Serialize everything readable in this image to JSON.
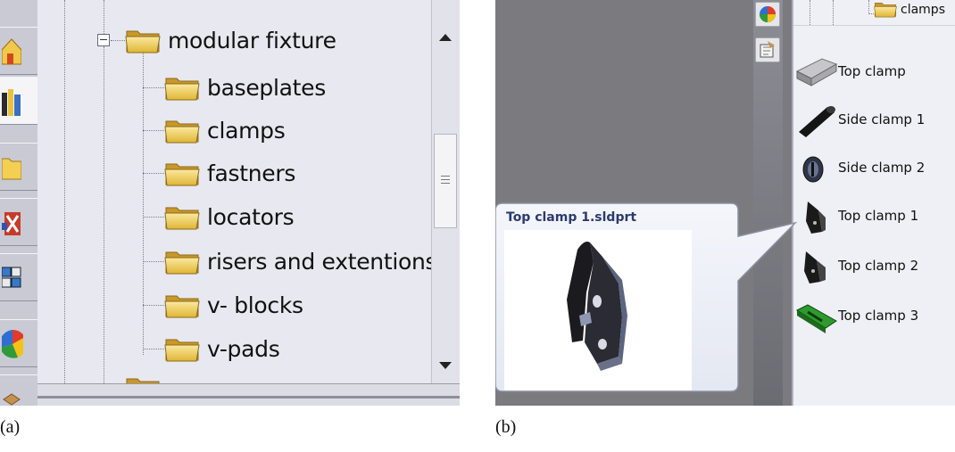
{
  "panel_a": {
    "caption": "(a)",
    "tree": {
      "parent_label": "modular fixture",
      "children": [
        {
          "label": "baseplates"
        },
        {
          "label": "clamps"
        },
        {
          "label": "fastners"
        },
        {
          "label": "locators"
        },
        {
          "label": "risers and extentions"
        },
        {
          "label": "v- blocks"
        },
        {
          "label": "v-pads"
        }
      ]
    },
    "toolbar_icons": [
      "home-icon",
      "design-library-icon",
      "folder-icon",
      "tool-icon",
      "view-palette-icon",
      "appearance-icon",
      "custom-properties-icon"
    ]
  },
  "panel_b": {
    "caption": "(b)",
    "library_header_folder": "clamps",
    "library_items": [
      {
        "label": "Top clamp",
        "icon": "top-clamp-icon"
      },
      {
        "label": "Side clamp 1",
        "icon": "side-clamp-1-icon"
      },
      {
        "label": "Side clamp 2",
        "icon": "side-clamp-2-icon"
      },
      {
        "label": "Top clamp 1",
        "icon": "top-clamp-1-icon"
      },
      {
        "label": "Top clamp 2",
        "icon": "top-clamp-2-icon"
      },
      {
        "label": "Top clamp 3",
        "icon": "top-clamp-3-icon"
      }
    ],
    "tooltip": {
      "title": "Top clamp 1.sldprt"
    }
  },
  "colors": {
    "folder_yellow": "#f2cf55",
    "tooltip_title": "#2c3a6e"
  }
}
